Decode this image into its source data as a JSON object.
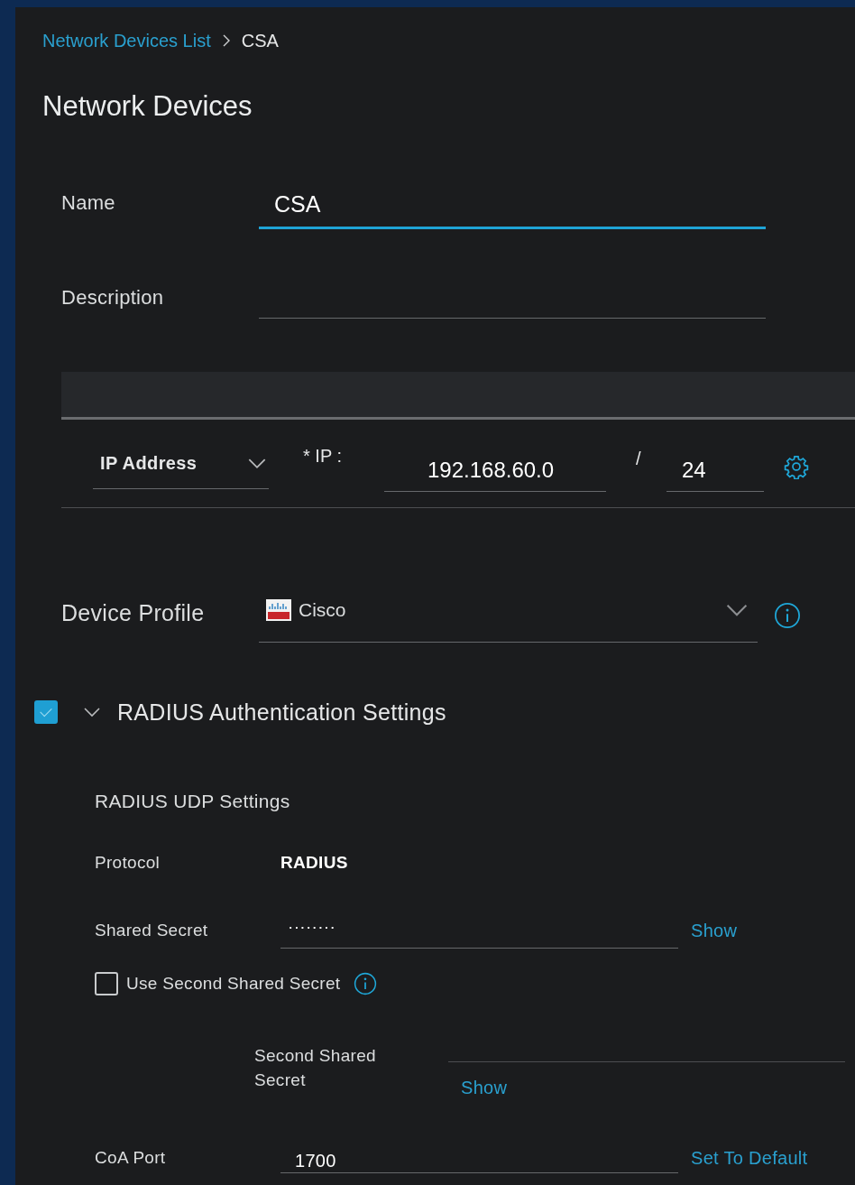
{
  "breadcrumb": {
    "link": "Network Devices List",
    "current": "CSA"
  },
  "title": "Network Devices",
  "name": {
    "label": "Name",
    "value": "CSA",
    "focused": true
  },
  "description": {
    "label": "Description"
  },
  "ip": {
    "type": "IP Address",
    "ip_label": "* IP :",
    "address": "192.168.60.0",
    "separator": "/",
    "mask": "24"
  },
  "device_profile": {
    "label": "Device Profile",
    "value": "Cisco"
  },
  "radius": {
    "title": "RADIUS Authentication Settings",
    "checked": true,
    "expanded": true,
    "udp_title": "RADIUS UDP Settings",
    "protocol_label": "Protocol",
    "protocol": "RADIUS",
    "shared_secret": {
      "label": "Shared Secret",
      "value": "········",
      "action": "Show"
    },
    "second": {
      "label": "Use Second Shared Secret",
      "checked": false
    },
    "second_secret": {
      "label": "Second Shared Secret",
      "action": "Show"
    },
    "coa": {
      "label": "CoA Port",
      "value": "1700",
      "action": "Set To Default"
    }
  }
}
